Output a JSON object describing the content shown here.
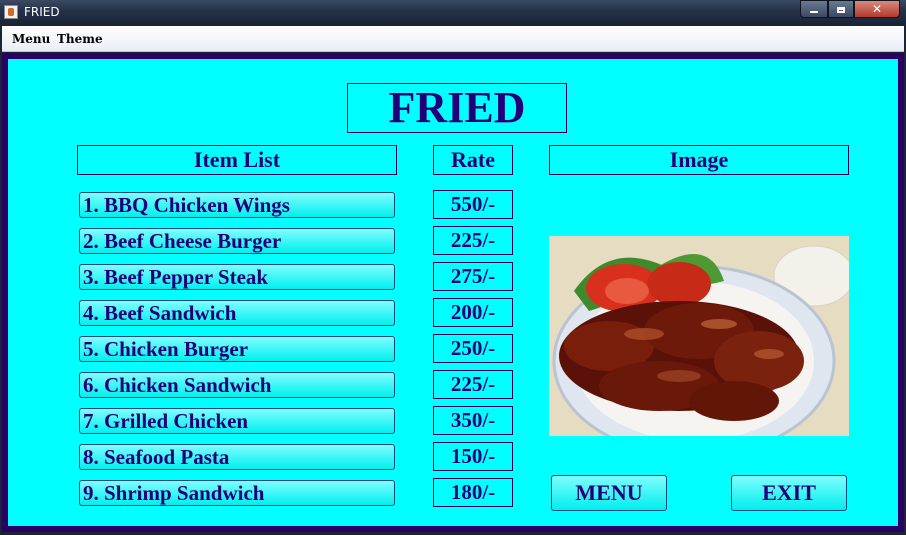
{
  "window": {
    "title": "FRIED"
  },
  "menubar": {
    "items": [
      {
        "label": "Menu"
      },
      {
        "label": "Theme"
      }
    ]
  },
  "page": {
    "title": "FRIED",
    "headers": {
      "items": "Item List",
      "rate": "Rate",
      "image": "Image"
    }
  },
  "items": [
    {
      "label": "1. BBQ Chicken Wings",
      "rate": "550/-"
    },
    {
      "label": "2. Beef Cheese Burger",
      "rate": "225/-"
    },
    {
      "label": "3. Beef Pepper Steak",
      "rate": "275/-"
    },
    {
      "label": "4. Beef Sandwich",
      "rate": "200/-"
    },
    {
      "label": "5. Chicken Burger",
      "rate": "250/-"
    },
    {
      "label": "6. Chicken Sandwich",
      "rate": "225/-"
    },
    {
      "label": "7. Grilled Chicken",
      "rate": "350/-"
    },
    {
      "label": "8. Seafood Pasta",
      "rate": "150/-"
    },
    {
      "label": "9. Shrimp Sandwich",
      "rate": "180/-"
    }
  ],
  "buttons": {
    "menu": "MENU",
    "exit": "EXIT"
  },
  "colors": {
    "background": "#00ffff",
    "border": "#2a0066",
    "text": "#22007a"
  }
}
